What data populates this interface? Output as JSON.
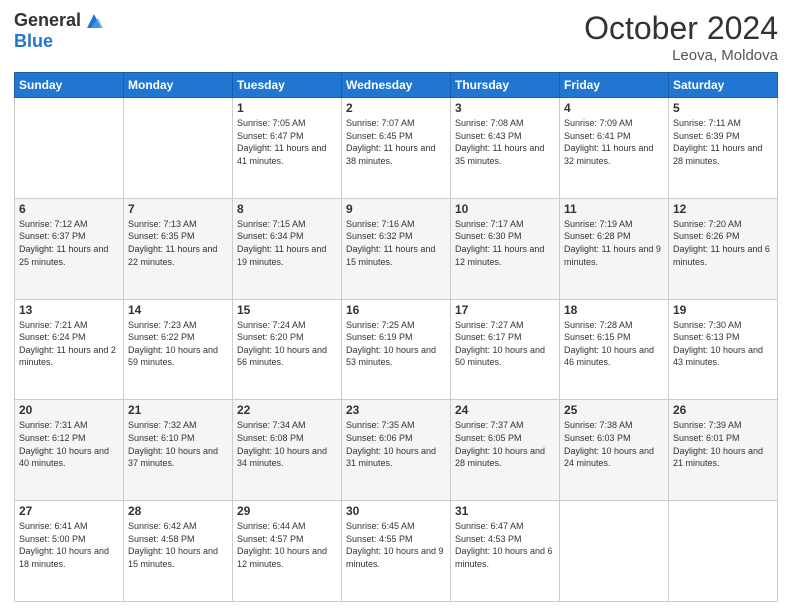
{
  "header": {
    "logo_general": "General",
    "logo_blue": "Blue",
    "title": "October 2024",
    "location": "Leova, Moldova"
  },
  "weekdays": [
    "Sunday",
    "Monday",
    "Tuesday",
    "Wednesday",
    "Thursday",
    "Friday",
    "Saturday"
  ],
  "weeks": [
    [
      {
        "day": "",
        "info": ""
      },
      {
        "day": "",
        "info": ""
      },
      {
        "day": "1",
        "info": "Sunrise: 7:05 AM\nSunset: 6:47 PM\nDaylight: 11 hours and 41 minutes."
      },
      {
        "day": "2",
        "info": "Sunrise: 7:07 AM\nSunset: 6:45 PM\nDaylight: 11 hours and 38 minutes."
      },
      {
        "day": "3",
        "info": "Sunrise: 7:08 AM\nSunset: 6:43 PM\nDaylight: 11 hours and 35 minutes."
      },
      {
        "day": "4",
        "info": "Sunrise: 7:09 AM\nSunset: 6:41 PM\nDaylight: 11 hours and 32 minutes."
      },
      {
        "day": "5",
        "info": "Sunrise: 7:11 AM\nSunset: 6:39 PM\nDaylight: 11 hours and 28 minutes."
      }
    ],
    [
      {
        "day": "6",
        "info": "Sunrise: 7:12 AM\nSunset: 6:37 PM\nDaylight: 11 hours and 25 minutes."
      },
      {
        "day": "7",
        "info": "Sunrise: 7:13 AM\nSunset: 6:35 PM\nDaylight: 11 hours and 22 minutes."
      },
      {
        "day": "8",
        "info": "Sunrise: 7:15 AM\nSunset: 6:34 PM\nDaylight: 11 hours and 19 minutes."
      },
      {
        "day": "9",
        "info": "Sunrise: 7:16 AM\nSunset: 6:32 PM\nDaylight: 11 hours and 15 minutes."
      },
      {
        "day": "10",
        "info": "Sunrise: 7:17 AM\nSunset: 6:30 PM\nDaylight: 11 hours and 12 minutes."
      },
      {
        "day": "11",
        "info": "Sunrise: 7:19 AM\nSunset: 6:28 PM\nDaylight: 11 hours and 9 minutes."
      },
      {
        "day": "12",
        "info": "Sunrise: 7:20 AM\nSunset: 6:26 PM\nDaylight: 11 hours and 6 minutes."
      }
    ],
    [
      {
        "day": "13",
        "info": "Sunrise: 7:21 AM\nSunset: 6:24 PM\nDaylight: 11 hours and 2 minutes."
      },
      {
        "day": "14",
        "info": "Sunrise: 7:23 AM\nSunset: 6:22 PM\nDaylight: 10 hours and 59 minutes."
      },
      {
        "day": "15",
        "info": "Sunrise: 7:24 AM\nSunset: 6:20 PM\nDaylight: 10 hours and 56 minutes."
      },
      {
        "day": "16",
        "info": "Sunrise: 7:25 AM\nSunset: 6:19 PM\nDaylight: 10 hours and 53 minutes."
      },
      {
        "day": "17",
        "info": "Sunrise: 7:27 AM\nSunset: 6:17 PM\nDaylight: 10 hours and 50 minutes."
      },
      {
        "day": "18",
        "info": "Sunrise: 7:28 AM\nSunset: 6:15 PM\nDaylight: 10 hours and 46 minutes."
      },
      {
        "day": "19",
        "info": "Sunrise: 7:30 AM\nSunset: 6:13 PM\nDaylight: 10 hours and 43 minutes."
      }
    ],
    [
      {
        "day": "20",
        "info": "Sunrise: 7:31 AM\nSunset: 6:12 PM\nDaylight: 10 hours and 40 minutes."
      },
      {
        "day": "21",
        "info": "Sunrise: 7:32 AM\nSunset: 6:10 PM\nDaylight: 10 hours and 37 minutes."
      },
      {
        "day": "22",
        "info": "Sunrise: 7:34 AM\nSunset: 6:08 PM\nDaylight: 10 hours and 34 minutes."
      },
      {
        "day": "23",
        "info": "Sunrise: 7:35 AM\nSunset: 6:06 PM\nDaylight: 10 hours and 31 minutes."
      },
      {
        "day": "24",
        "info": "Sunrise: 7:37 AM\nSunset: 6:05 PM\nDaylight: 10 hours and 28 minutes."
      },
      {
        "day": "25",
        "info": "Sunrise: 7:38 AM\nSunset: 6:03 PM\nDaylight: 10 hours and 24 minutes."
      },
      {
        "day": "26",
        "info": "Sunrise: 7:39 AM\nSunset: 6:01 PM\nDaylight: 10 hours and 21 minutes."
      }
    ],
    [
      {
        "day": "27",
        "info": "Sunrise: 6:41 AM\nSunset: 5:00 PM\nDaylight: 10 hours and 18 minutes."
      },
      {
        "day": "28",
        "info": "Sunrise: 6:42 AM\nSunset: 4:58 PM\nDaylight: 10 hours and 15 minutes."
      },
      {
        "day": "29",
        "info": "Sunrise: 6:44 AM\nSunset: 4:57 PM\nDaylight: 10 hours and 12 minutes."
      },
      {
        "day": "30",
        "info": "Sunrise: 6:45 AM\nSunset: 4:55 PM\nDaylight: 10 hours and 9 minutes."
      },
      {
        "day": "31",
        "info": "Sunrise: 6:47 AM\nSunset: 4:53 PM\nDaylight: 10 hours and 6 minutes."
      },
      {
        "day": "",
        "info": ""
      },
      {
        "day": "",
        "info": ""
      }
    ]
  ]
}
